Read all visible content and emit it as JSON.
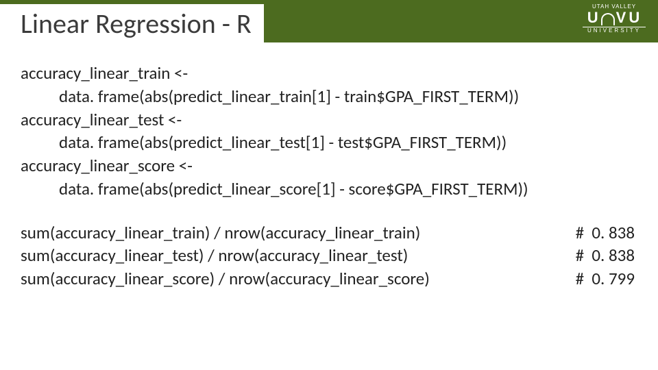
{
  "header": {
    "title": "Linear Regression - R",
    "logo_top": "UTAH VALLEY",
    "logo_u": "U",
    "logo_v": "V",
    "logo_u2": "U",
    "logo_bot": "UNIVERSITY"
  },
  "code": {
    "l1": "accuracy_linear_train <-",
    "l2": "data. frame(abs(predict_linear_train[1] - train$GPA_FIRST_TERM))",
    "l3": "accuracy_linear_test <-",
    "l4": "data. frame(abs(predict_linear_test[1] - test$GPA_FIRST_TERM))",
    "l5": "accuracy_linear_score <-",
    "l6": "data. frame(abs(predict_linear_score[1] - score$GPA_FIRST_TERM))",
    "r1_left": "sum(accuracy_linear_train) / nrow(accuracy_linear_train)",
    "r1_right": "#  0. 838",
    "r2_left": "sum(accuracy_linear_test) / nrow(accuracy_linear_test)",
    "r2_right": "#  0. 838",
    "r3_left": "sum(accuracy_linear_score) / nrow(accuracy_linear_score)",
    "r3_right": "#  0. 799"
  }
}
